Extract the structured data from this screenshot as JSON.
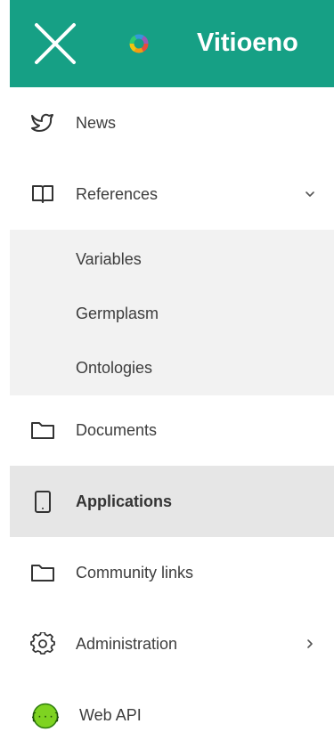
{
  "header": {
    "title": "Vitioeno",
    "close_icon": "close-icon",
    "logo_icon": "multicolor-ring-logo",
    "background_color": "#16a085"
  },
  "menu": {
    "news": {
      "label": "News",
      "icon": "twitter-bird-icon"
    },
    "references": {
      "label": "References",
      "icon": "open-book-icon",
      "expanded": true,
      "children": [
        {
          "label": "Variables"
        },
        {
          "label": "Germplasm"
        },
        {
          "label": "Ontologies"
        }
      ]
    },
    "documents": {
      "label": "Documents",
      "icon": "folder-icon"
    },
    "applications": {
      "label": "Applications",
      "icon": "tablet-icon",
      "active": true
    },
    "community_links": {
      "label": "Community links",
      "icon": "folder-icon"
    },
    "administration": {
      "label": "Administration",
      "icon": "gear-icon"
    },
    "web_api": {
      "label": "Web API",
      "icon": "api-braces-icon",
      "icon_color": "#7ed321"
    }
  },
  "colors": {
    "active_background": "#e6e6e6",
    "submenu_background": "#f2f2f2",
    "text": "#3d3d3d"
  }
}
